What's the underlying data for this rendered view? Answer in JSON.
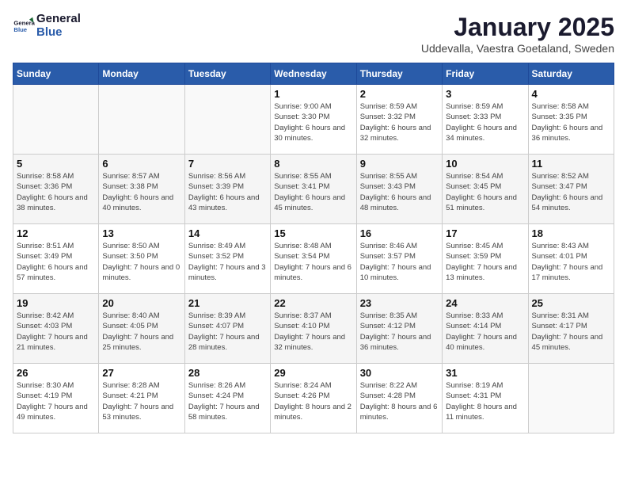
{
  "header": {
    "logo_line1": "General",
    "logo_line2": "Blue",
    "month_title": "January 2025",
    "subtitle": "Uddevalla, Vaestra Goetaland, Sweden"
  },
  "weekdays": [
    "Sunday",
    "Monday",
    "Tuesday",
    "Wednesday",
    "Thursday",
    "Friday",
    "Saturday"
  ],
  "weeks": [
    [
      {
        "day": "",
        "info": ""
      },
      {
        "day": "",
        "info": ""
      },
      {
        "day": "",
        "info": ""
      },
      {
        "day": "1",
        "info": "Sunrise: 9:00 AM\nSunset: 3:30 PM\nDaylight: 6 hours\nand 30 minutes."
      },
      {
        "day": "2",
        "info": "Sunrise: 8:59 AM\nSunset: 3:32 PM\nDaylight: 6 hours\nand 32 minutes."
      },
      {
        "day": "3",
        "info": "Sunrise: 8:59 AM\nSunset: 3:33 PM\nDaylight: 6 hours\nand 34 minutes."
      },
      {
        "day": "4",
        "info": "Sunrise: 8:58 AM\nSunset: 3:35 PM\nDaylight: 6 hours\nand 36 minutes."
      }
    ],
    [
      {
        "day": "5",
        "info": "Sunrise: 8:58 AM\nSunset: 3:36 PM\nDaylight: 6 hours\nand 38 minutes."
      },
      {
        "day": "6",
        "info": "Sunrise: 8:57 AM\nSunset: 3:38 PM\nDaylight: 6 hours\nand 40 minutes."
      },
      {
        "day": "7",
        "info": "Sunrise: 8:56 AM\nSunset: 3:39 PM\nDaylight: 6 hours\nand 43 minutes."
      },
      {
        "day": "8",
        "info": "Sunrise: 8:55 AM\nSunset: 3:41 PM\nDaylight: 6 hours\nand 45 minutes."
      },
      {
        "day": "9",
        "info": "Sunrise: 8:55 AM\nSunset: 3:43 PM\nDaylight: 6 hours\nand 48 minutes."
      },
      {
        "day": "10",
        "info": "Sunrise: 8:54 AM\nSunset: 3:45 PM\nDaylight: 6 hours\nand 51 minutes."
      },
      {
        "day": "11",
        "info": "Sunrise: 8:52 AM\nSunset: 3:47 PM\nDaylight: 6 hours\nand 54 minutes."
      }
    ],
    [
      {
        "day": "12",
        "info": "Sunrise: 8:51 AM\nSunset: 3:49 PM\nDaylight: 6 hours\nand 57 minutes."
      },
      {
        "day": "13",
        "info": "Sunrise: 8:50 AM\nSunset: 3:50 PM\nDaylight: 7 hours\nand 0 minutes."
      },
      {
        "day": "14",
        "info": "Sunrise: 8:49 AM\nSunset: 3:52 PM\nDaylight: 7 hours\nand 3 minutes."
      },
      {
        "day": "15",
        "info": "Sunrise: 8:48 AM\nSunset: 3:54 PM\nDaylight: 7 hours\nand 6 minutes."
      },
      {
        "day": "16",
        "info": "Sunrise: 8:46 AM\nSunset: 3:57 PM\nDaylight: 7 hours\nand 10 minutes."
      },
      {
        "day": "17",
        "info": "Sunrise: 8:45 AM\nSunset: 3:59 PM\nDaylight: 7 hours\nand 13 minutes."
      },
      {
        "day": "18",
        "info": "Sunrise: 8:43 AM\nSunset: 4:01 PM\nDaylight: 7 hours\nand 17 minutes."
      }
    ],
    [
      {
        "day": "19",
        "info": "Sunrise: 8:42 AM\nSunset: 4:03 PM\nDaylight: 7 hours\nand 21 minutes."
      },
      {
        "day": "20",
        "info": "Sunrise: 8:40 AM\nSunset: 4:05 PM\nDaylight: 7 hours\nand 25 minutes."
      },
      {
        "day": "21",
        "info": "Sunrise: 8:39 AM\nSunset: 4:07 PM\nDaylight: 7 hours\nand 28 minutes."
      },
      {
        "day": "22",
        "info": "Sunrise: 8:37 AM\nSunset: 4:10 PM\nDaylight: 7 hours\nand 32 minutes."
      },
      {
        "day": "23",
        "info": "Sunrise: 8:35 AM\nSunset: 4:12 PM\nDaylight: 7 hours\nand 36 minutes."
      },
      {
        "day": "24",
        "info": "Sunrise: 8:33 AM\nSunset: 4:14 PM\nDaylight: 7 hours\nand 40 minutes."
      },
      {
        "day": "25",
        "info": "Sunrise: 8:31 AM\nSunset: 4:17 PM\nDaylight: 7 hours\nand 45 minutes."
      }
    ],
    [
      {
        "day": "26",
        "info": "Sunrise: 8:30 AM\nSunset: 4:19 PM\nDaylight: 7 hours\nand 49 minutes."
      },
      {
        "day": "27",
        "info": "Sunrise: 8:28 AM\nSunset: 4:21 PM\nDaylight: 7 hours\nand 53 minutes."
      },
      {
        "day": "28",
        "info": "Sunrise: 8:26 AM\nSunset: 4:24 PM\nDaylight: 7 hours\nand 58 minutes."
      },
      {
        "day": "29",
        "info": "Sunrise: 8:24 AM\nSunset: 4:26 PM\nDaylight: 8 hours\nand 2 minutes."
      },
      {
        "day": "30",
        "info": "Sunrise: 8:22 AM\nSunset: 4:28 PM\nDaylight: 8 hours\nand 6 minutes."
      },
      {
        "day": "31",
        "info": "Sunrise: 8:19 AM\nSunset: 4:31 PM\nDaylight: 8 hours\nand 11 minutes."
      },
      {
        "day": "",
        "info": ""
      }
    ]
  ]
}
